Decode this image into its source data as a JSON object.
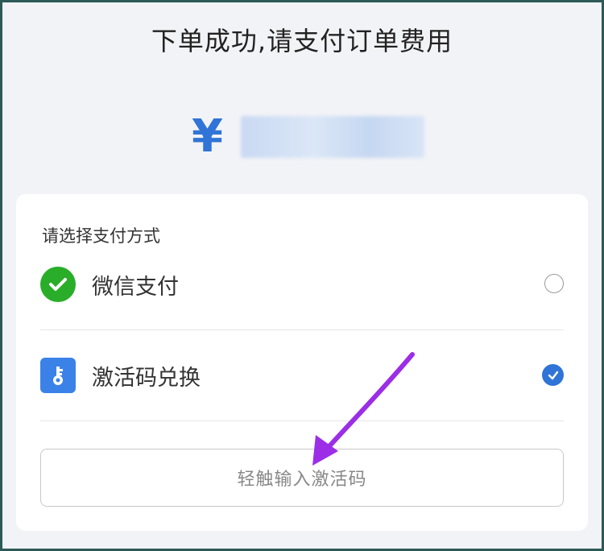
{
  "header": {
    "title": "下单成功,请支付订单费用"
  },
  "amount": {
    "currency_symbol": "¥"
  },
  "payment": {
    "section_title": "请选择支付方式",
    "options": [
      {
        "label": "微信支付",
        "icon": "wechat-icon",
        "selected": false
      },
      {
        "label": "激活码兑换",
        "icon": "key-icon",
        "selected": true
      }
    ],
    "code_input_button": "轻触输入激活码"
  },
  "colors": {
    "accent": "#2f74d6",
    "wechat_green": "#2aae2a",
    "annotation_arrow": "#9b2ee6"
  }
}
